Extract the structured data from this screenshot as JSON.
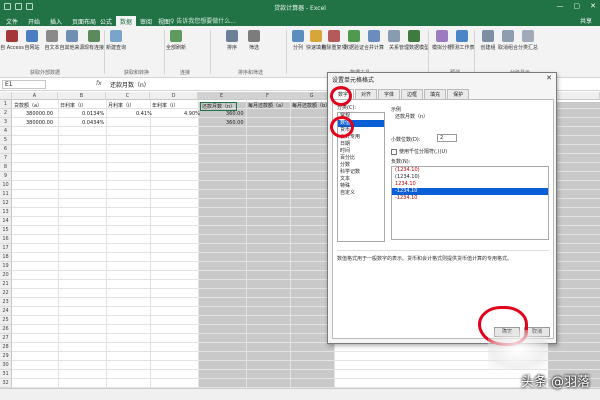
{
  "window": {
    "title": "贷款计算器 - Excel",
    "controls": [
      "—",
      "▢",
      "✕"
    ]
  },
  "tabs": [
    {
      "label": "文件"
    },
    {
      "label": "开始"
    },
    {
      "label": "插入"
    },
    {
      "label": "页面布局"
    },
    {
      "label": "公式"
    },
    {
      "label": "数据"
    },
    {
      "label": "审阅"
    },
    {
      "label": "视图"
    }
  ],
  "tell_me": "♀ 告诉我您想要做什么...",
  "share": "共享",
  "ribbon": {
    "buttons": [
      "自 Access",
      "自网站",
      "自文本",
      "自其他来源",
      "现有连接",
      "新建查询",
      "全部刷新",
      "排序",
      "筛选",
      "分列",
      "快速填充",
      "删除重复项",
      "数据验证",
      "合并计算",
      "关系",
      "管理数据模型",
      "模拟分析",
      "预测工作表",
      "创建组",
      "取消组合",
      "分类汇总"
    ],
    "groups": [
      "获取外部数据",
      "获取和转换",
      "连接",
      "排序和筛选",
      "数据工具",
      "预测",
      "分级显示"
    ]
  },
  "formula_bar": {
    "name_box": "E1",
    "fx": "fx",
    "formula": "还款月数（n）"
  },
  "columns": [
    "A",
    "B",
    "C",
    "D",
    "E",
    "F",
    "G",
    "H"
  ],
  "rows": [
    "1",
    "2",
    "3",
    "4",
    "5",
    "6",
    "7",
    "8",
    "9",
    "10",
    "11",
    "12",
    "13",
    "14",
    "15",
    "16",
    "17",
    "18",
    "19",
    "20",
    "21",
    "22",
    "23",
    "24",
    "25",
    "26",
    "27",
    "28",
    "29",
    "30",
    "31",
    "32"
  ],
  "headers": {
    "a": "贷款额（a）",
    "b": "日利率（i）",
    "c": "月利率（i）",
    "d": "年利率（i）",
    "e": "还款月数（n）",
    "f": "每月还款额（a）",
    "g": "每月还款额（b）"
  },
  "row2": {
    "a": "380000.00",
    "b": "0.0134%",
    "c": "0.41%",
    "d": "4.90%",
    "e": "360.00"
  },
  "row3": {
    "a": "380000.00",
    "b": "0.0434%",
    "e": "360.00"
  },
  "dialog": {
    "title": "设置单元格格式",
    "close": "✕",
    "tabs": [
      "数字",
      "对齐",
      "字体",
      "边框",
      "填充",
      "保护"
    ],
    "category_label": "分类(C):",
    "categories": [
      "常规",
      "数值",
      "货币",
      "会计专用",
      "日期",
      "时间",
      "百分比",
      "分数",
      "科学记数",
      "文本",
      "特殊",
      "自定义"
    ],
    "sample_label": "示例",
    "sample_value": "还款月数（n）",
    "decimal_label": "小数位数(D):",
    "decimal_value": "2",
    "thousands_label": "使用千位分隔符(,)(U)",
    "negative_label": "负数(N):",
    "negative_options": [
      "(1234.10)",
      "(1234.10)",
      "1234.10",
      "-1234.10",
      "-1234.10"
    ],
    "description": "数值格式用于一般数字的表示。货币和会计格式则提供货币值计算的专用格式。",
    "ok": "确定",
    "cancel": "取消"
  },
  "watermark": "头条 @羽落",
  "colors": {
    "excel_green": "#217346",
    "annotation_red": "#e2001a",
    "selection_blue": "#0b5fd6"
  }
}
